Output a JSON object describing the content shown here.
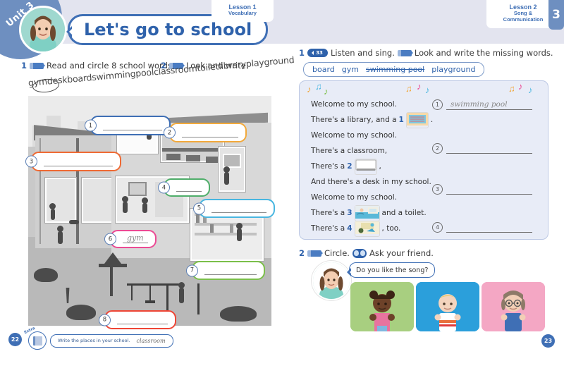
{
  "header": {
    "unit_label": "Unit 3",
    "unit_number": "3",
    "title": "Let's go to school",
    "lesson_left": {
      "line1": "Lesson 1",
      "line2": "Vocabulary"
    },
    "lesson_right": {
      "line1": "Lesson 2",
      "line2": "Song &",
      "line3": "Communication"
    },
    "accent_blue": "#3f6fb5",
    "band_color": "#e3e4ef",
    "unit_circle_color": "#6e8fc0"
  },
  "left_page": {
    "page_number": "22",
    "exercises": [
      {
        "number": "1",
        "icon": "pen-icon",
        "text": "Read and circle 8 school words."
      },
      {
        "number": "2",
        "icon": "pen-icon",
        "text": "Look and write."
      }
    ],
    "word_string": "gymdeskboardswimmingpoolclassroomtoiletlibraryplayground",
    "circled_word": "gym",
    "callouts": [
      {
        "number": "1",
        "answer": "",
        "color": "#3f6fb5"
      },
      {
        "number": "2",
        "answer": "",
        "color": "#f2a93b"
      },
      {
        "number": "3",
        "answer": "",
        "color": "#ef6a34"
      },
      {
        "number": "4",
        "answer": "",
        "color": "#4fae6a"
      },
      {
        "number": "5",
        "answer": "",
        "color": "#49b6e0"
      },
      {
        "number": "6",
        "answer": "gym",
        "color": "#ec4a94"
      },
      {
        "number": "7",
        "answer": "",
        "color": "#7bbf4a"
      },
      {
        "number": "8",
        "answer": "",
        "color": "#ef4636"
      }
    ],
    "extra": {
      "badge_ribbon": "Extra",
      "label": "Write the places in your school.",
      "answer": "classroom"
    }
  },
  "right_page": {
    "page_number": "23",
    "exercise1": {
      "number": "1",
      "audio_icon": "audio-icon",
      "audio_track": "33",
      "text_a": "Listen and sing.",
      "pen_icon": "pen-icon",
      "text_b": "Look and write the missing words."
    },
    "word_bank": [
      {
        "word": "board",
        "struck": false
      },
      {
        "word": "gym",
        "struck": false
      },
      {
        "word": "swimming pool",
        "struck": true
      },
      {
        "word": "playground",
        "struck": false
      }
    ],
    "lyrics": [
      {
        "parts": [
          {
            "t": "Welcome to my school.",
            "bold": false
          }
        ]
      },
      {
        "parts": [
          {
            "t": "There's a library, and a ",
            "bold": false
          },
          {
            "t": "1",
            "bold": true
          },
          {
            "t": "img:board",
            "bold": false
          },
          {
            "t": ".",
            "bold": false
          }
        ]
      },
      {
        "parts": [
          {
            "t": "Welcome to my school.",
            "bold": false
          }
        ]
      },
      {
        "parts": [
          {
            "t": "There's a classroom,",
            "bold": false
          }
        ]
      },
      {
        "parts": [
          {
            "t": "There's a ",
            "bold": false
          },
          {
            "t": "2",
            "bold": true
          },
          {
            "t": "img:whiteboard",
            "bold": false
          },
          {
            "t": ",",
            "bold": false
          }
        ]
      },
      {
        "parts": [
          {
            "t": "And there's a desk in my school.",
            "bold": false
          }
        ]
      },
      {
        "parts": [
          {
            "t": "Welcome to my school.",
            "bold": false
          }
        ]
      },
      {
        "parts": [
          {
            "t": "There's a ",
            "bold": false
          },
          {
            "t": "3",
            "bold": true
          },
          {
            "t": "img:pool",
            "bold": false
          },
          {
            "t": " and a toilet.",
            "bold": false
          }
        ]
      },
      {
        "parts": [
          {
            "t": "There's a ",
            "bold": false
          },
          {
            "t": "4",
            "bold": true
          },
          {
            "t": "img:gym",
            "bold": false
          },
          {
            "t": ", too.",
            "bold": false
          }
        ]
      }
    ],
    "answers": [
      {
        "number": "1",
        "value": "swimming pool"
      },
      {
        "number": "2",
        "value": ""
      },
      {
        "number": "3",
        "value": ""
      },
      {
        "number": "4",
        "value": ""
      }
    ],
    "exercise2": {
      "number": "2",
      "pen_icon": "pen-icon",
      "text_a": "Circle.",
      "pair_icon": "pair-icon",
      "text_b": "Ask your friend."
    },
    "speech_bubble": "Do you like the song?",
    "kid_cards": [
      {
        "name": "kid-card-green",
        "bg": "#a8cf80",
        "skin": "#6d4229",
        "shirt": "#e8739f",
        "hair": "#3c2415"
      },
      {
        "name": "kid-card-blue",
        "bg": "#2b9fdb",
        "skin": "#f4d4be",
        "shirt": "#ffffff",
        "hair": "#e7c96a"
      },
      {
        "name": "kid-card-pink",
        "bg": "#f4a7c4",
        "skin": "#f2cfb6",
        "shirt": "#3f6fb5",
        "hair": "#8d7a68"
      }
    ]
  }
}
